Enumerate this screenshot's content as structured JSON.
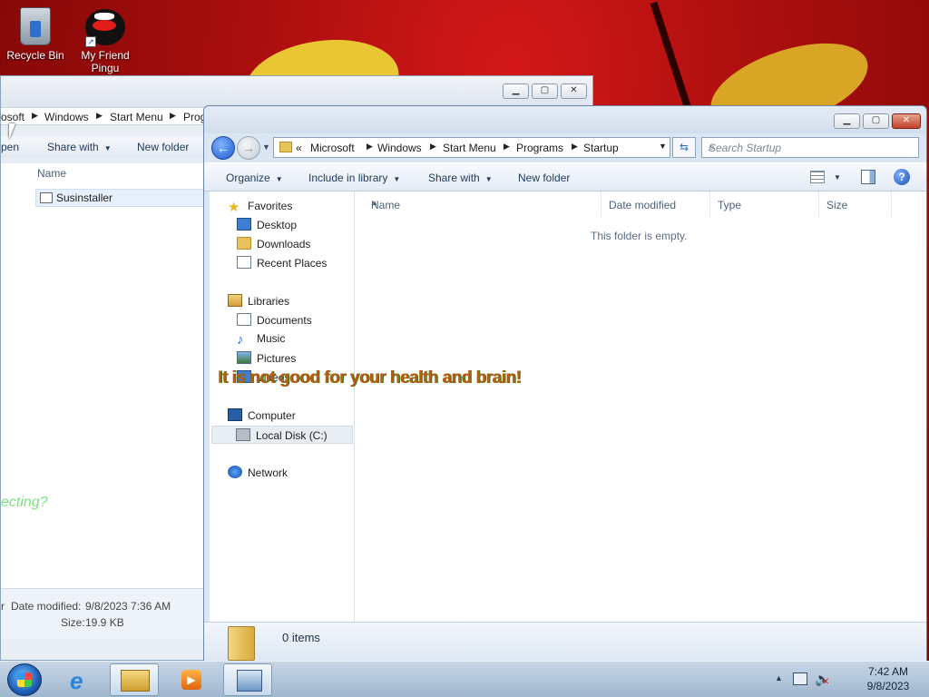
{
  "desktop": {
    "icons": [
      {
        "label": "Recycle Bin",
        "icon": "recycle-bin-icon"
      },
      {
        "label": "My Friend Pingu",
        "icon": "pingu-icon"
      }
    ]
  },
  "back_window": {
    "address_segments": [
      "osoft",
      "Windows",
      "Start Menu",
      "Prog"
    ],
    "toolbar": {
      "open_label": "pen",
      "share_label": "Share with",
      "new_folder_label": "New folder"
    },
    "column_name": "Name",
    "file_name": "Susinstaller",
    "partial_text": "ecting?",
    "details": {
      "kind_fragment": "r",
      "date_label": "Date modified:",
      "date_value": "9/8/2023 7:36 AM",
      "size_label": "Size:",
      "size_value": "19.9 KB"
    }
  },
  "front_window": {
    "breadcrumb_prefix": "«",
    "breadcrumb": [
      "Microsoft",
      "Windows",
      "Start Menu",
      "Programs",
      "Startup"
    ],
    "search_placeholder": "Search Startup",
    "toolbar": {
      "organize": "Organize",
      "include_in_library": "Include in library",
      "share_with": "Share with",
      "new_folder": "New folder"
    },
    "nav": {
      "favorites": "Favorites",
      "desktop": "Desktop",
      "downloads": "Downloads",
      "recent_places": "Recent Places",
      "libraries": "Libraries",
      "documents": "Documents",
      "music": "Music",
      "pictures": "Pictures",
      "videos": "Videos",
      "computer": "Computer",
      "local_disk": "Local Disk (C:)",
      "network": "Network"
    },
    "columns": {
      "name": "Name",
      "date_modified": "Date modified",
      "type": "Type",
      "size": "Size"
    },
    "empty_message": "This folder is empty.",
    "status": "0 items"
  },
  "overlay_text": "It is not good for your health and brain!",
  "taskbar": {
    "time": "7:42 AM",
    "date": "9/8/2023"
  },
  "colors": {
    "accent": "#1d5ad0",
    "overlay": "#b95d0d"
  }
}
